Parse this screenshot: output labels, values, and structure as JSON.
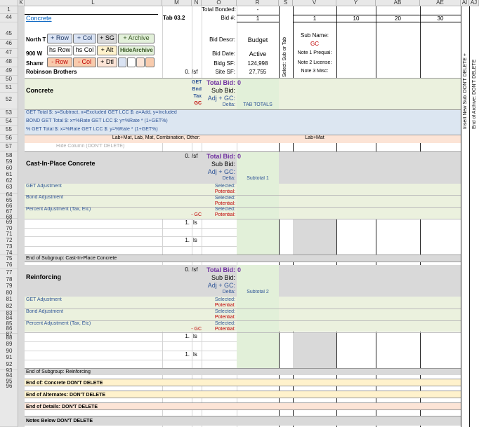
{
  "columns": [
    "K",
    "L",
    "M",
    "N",
    "O",
    "R",
    "S",
    "V",
    "Y",
    "AB",
    "AE",
    "AI",
    "AJ"
  ],
  "row_numbers": [
    "1",
    "44",
    "45",
    "46",
    "47",
    "48",
    "49",
    "50",
    "51",
    "52",
    "53",
    "54",
    "55",
    "56",
    "57",
    "58",
    "59",
    "60",
    "61",
    "62",
    "63",
    "64",
    "65",
    "66",
    "67",
    "68",
    "69",
    "70",
    "71",
    "72",
    "73",
    "74",
    "75",
    "76",
    "77",
    "78",
    "79",
    "80",
    "81",
    "82",
    "83",
    "84",
    "85",
    "86",
    "87",
    "88",
    "89",
    "90",
    "91",
    "92",
    "93",
    "94",
    "95",
    "96"
  ],
  "toolbar": {
    "add_row": "+ Row",
    "add_col": "+ Col",
    "add_sg": "+ SG",
    "add_archive": "+ Archive",
    "hs_row": "hs Row",
    "hs_col": "hs Col",
    "add_alt": "+ Alt",
    "hide_archive": "HideArchive",
    "del_row": "- Row",
    "del_col": "- Col",
    "add_dtl": "+ Dtl"
  },
  "header": {
    "total_bonded": "Total Bonded:",
    "total_bonded_value": "-",
    "concrete_link": "Concrete",
    "tab": "Tab 03.2",
    "north": "North T",
    "address": "900 W",
    "shamr": "Shamr",
    "company": "Robinson Brothers",
    "zero": "0.",
    "sf": "/sf",
    "bid_no": "Bid #:",
    "bid_descr": "Bid Descr:",
    "bid_date": "Bid Date:",
    "bldg_sf": "Bldg SF:",
    "site_sf": "Site SF:",
    "col_nums": [
      "1",
      "1",
      "10",
      "20",
      "30"
    ],
    "budget": "Budget",
    "active": "Active",
    "bldg_sf_value": "124,998",
    "site_sf_value": "27,755",
    "sub_name": "Sub Name:",
    "gc": "GC",
    "note1": "Note 1 Prequal:",
    "note2": "Note 2 License:",
    "note3": "Note 3 Misc:",
    "select_sub": "Select: Sub or Tab",
    "side1": "Insert New Sub: DON'T DELETE  +",
    "side2": "End of Archive: DON'T DELETE"
  },
  "totals": {
    "title": "Concrete",
    "get": "GET",
    "bnd": "Bnd",
    "tax": "Tax",
    "gc": "GC",
    "total_bid": "Total Bid:",
    "total_value": "0",
    "sub_bid": "Sub Bid:",
    "adj": "Adj + GC:",
    "delta": "Delta:",
    "tab_totals": "TAB TOTALS",
    "row53": "GET Total $: s=Subtract, x=Excluded   GET LCC $: a=Add, y=Included",
    "row54": "BOND  GET Total $: x=%Rate  GET LCC $: y=%Rate * (1+GET%)",
    "row55": "%      GET Total $: x=%Rate  GET LCC $: y=%Rate * (1+GET%)",
    "row56": "Lab+Mat, Lab, Mat, Combination, Other:",
    "row56_v": "Lab+Mat",
    "row57": "Hide Column (DON'T DELETE)"
  },
  "groups": [
    {
      "title": "Cast-In-Place Concrete",
      "subtotal": "Subtotal 1",
      "end": "End of Subgroup: Cast-In-Place Concrete"
    },
    {
      "title": "Reinforcing",
      "subtotal": "Subtotal 2",
      "end": "End of Subgroup: Reinforcing"
    }
  ],
  "group_common": {
    "zero": "0.",
    "sf": "/sf",
    "total_bid": "Total Bid:",
    "total_value": "0",
    "sub_bid": "Sub Bid:",
    "adj": "Adj + GC:",
    "delta": "Delta:",
    "get_adj": "GET Adjustment",
    "bond_adj": "Bond Adjustment",
    "pct_adj": "Percent Adjustment (Tax, Etc)",
    "selected": "Selected:",
    "potential": "Potential:",
    "minus_gc": "-  GC",
    "one": "1.",
    "ls": "ls"
  },
  "footer": {
    "end_of": "End of:  Concrete DON'T DELETE",
    "end_alt": "End of Alternates: DON'T DELETE",
    "end_details": "End of Details: DON'T DELETE",
    "notes": "Notes Below  DON'T DELETE"
  },
  "colors": {
    "green": "#ebf1de",
    "green2": "#e2f0d9",
    "gray": "#d9d9d9",
    "blue_band": "#dce6f1",
    "peach": "#fce4d6",
    "yellow": "#fff2cc"
  }
}
